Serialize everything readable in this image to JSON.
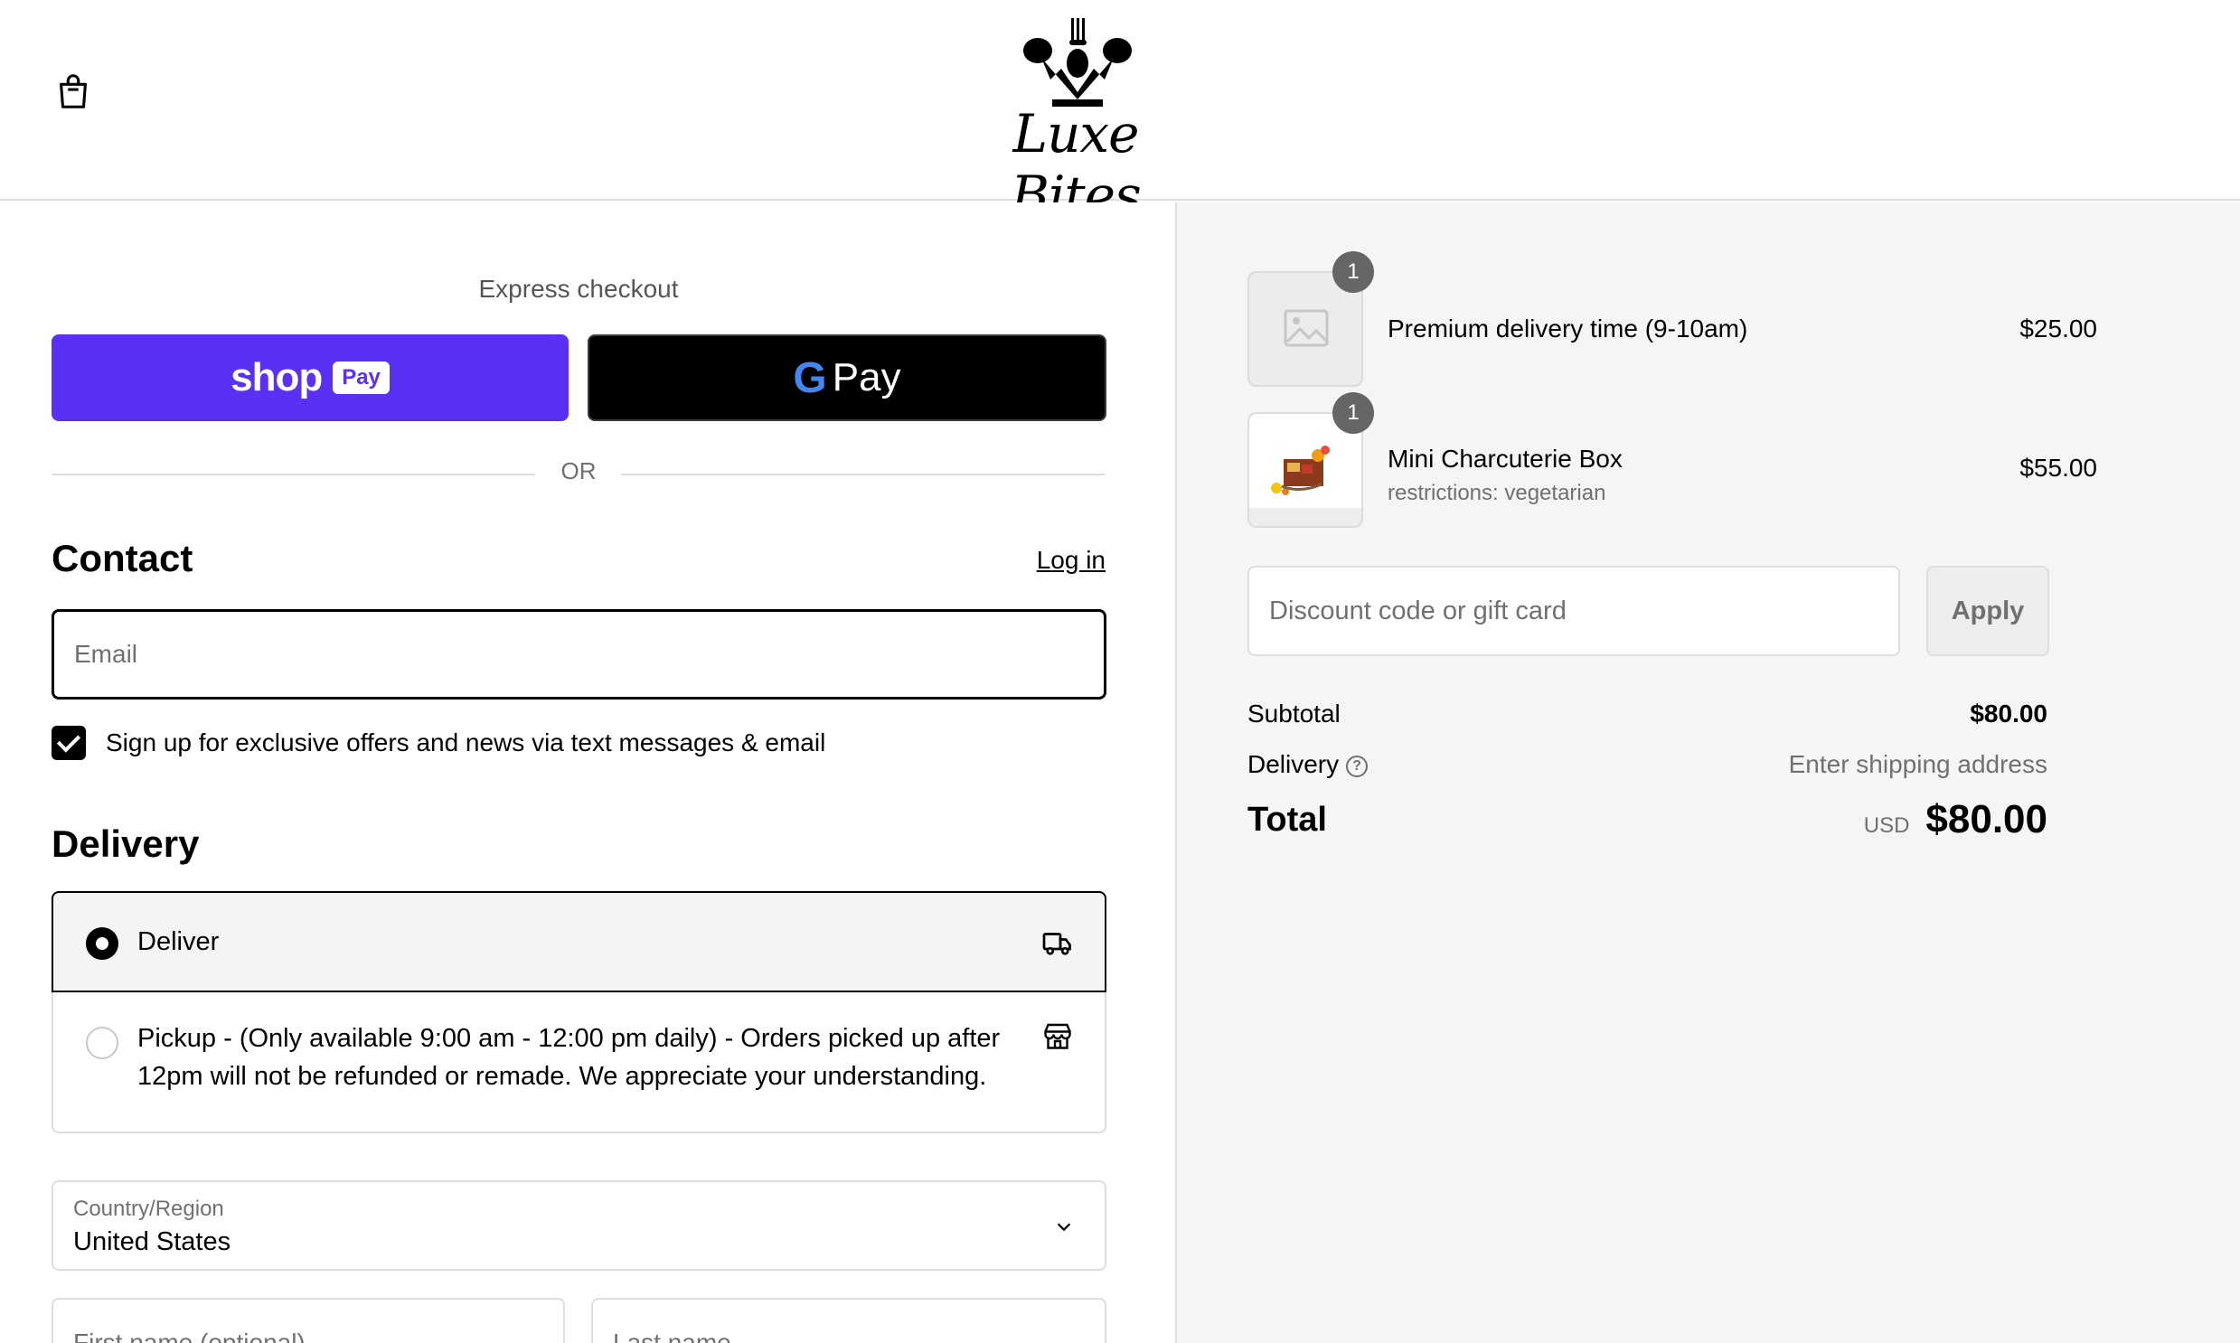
{
  "header": {
    "brand": "Luxe Bites"
  },
  "express": {
    "title": "Express checkout",
    "shop_pay_word": "shop",
    "shop_pay_badge": "Pay",
    "gpay_g": "G",
    "gpay_word": "Pay",
    "or_label": "OR"
  },
  "contact": {
    "title": "Contact",
    "login_label": "Log in",
    "email_placeholder": "Email",
    "marketing_opt_in": "Sign up for exclusive offers and news via text messages & email",
    "marketing_checked": true
  },
  "delivery": {
    "title": "Delivery",
    "options": [
      {
        "label": "Deliver",
        "selected": true,
        "icon": "truck-icon"
      },
      {
        "label": "Pickup - (Only available 9:00 am - 12:00 pm daily) - Orders picked up after 12pm will not be refunded or remade. We appreciate your understanding.",
        "selected": false,
        "icon": "store-icon"
      }
    ],
    "country_label": "Country/Region",
    "country_value": "United States",
    "first_name_placeholder": "First name (optional)",
    "last_name_placeholder": "Last name"
  },
  "summary": {
    "items": [
      {
        "quantity": "1",
        "name": "Premium delivery time (9-10am)",
        "price": "$25.00",
        "image": "placeholder-image-icon"
      },
      {
        "quantity": "1",
        "name": "Mini Charcuterie Box",
        "subtitle": "restrictions: vegetarian",
        "price": "$55.00",
        "image": "charcuterie-box-photo"
      }
    ],
    "discount_placeholder": "Discount code or gift card",
    "apply_label": "Apply",
    "subtotal_label": "Subtotal",
    "subtotal_value": "$80.00",
    "delivery_label": "Delivery",
    "delivery_value": "Enter shipping address",
    "total_label": "Total",
    "currency": "USD",
    "total_value": "$80.00"
  },
  "colors": {
    "shop_pay": "#5a31f4",
    "gpay": "#000000",
    "summary_bg": "#f5f5f5"
  }
}
